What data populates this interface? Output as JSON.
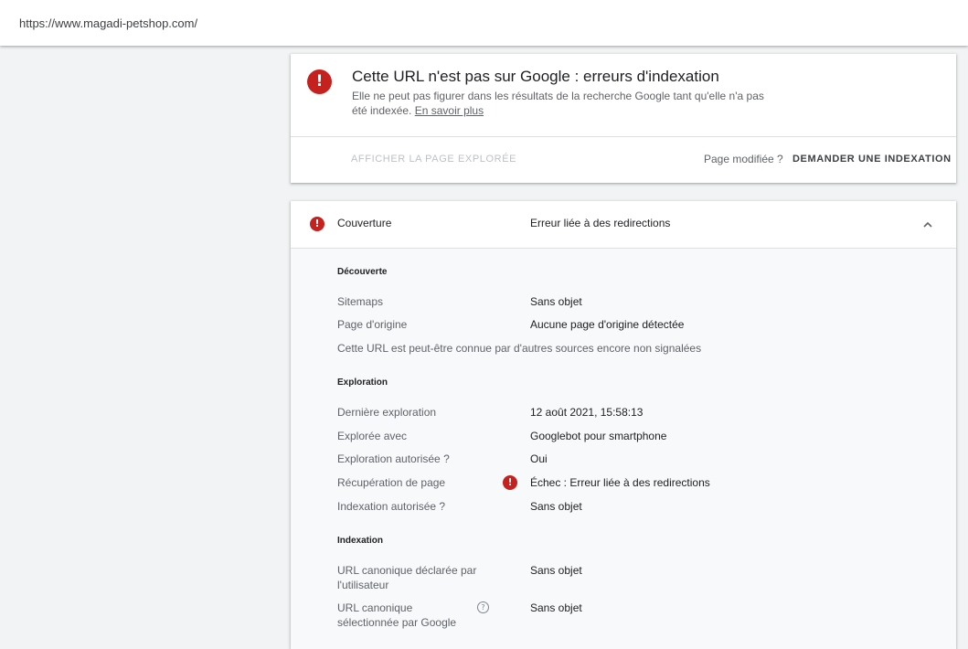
{
  "topbar": {
    "url": "https://www.magadi-petshop.com/"
  },
  "status": {
    "title": "Cette URL n'est pas sur Google : erreurs d'indexation",
    "description": "Elle ne peut pas figurer dans les résultats de la recherche Google tant qu'elle n'a pas été indexée.",
    "learn_more": "En savoir plus",
    "error_icon": "error-icon",
    "btn_view_crawled": "AFFICHER LA PAGE EXPLORÉE",
    "page_modified": "Page modifiée ?",
    "btn_request_index": "DEMANDER UNE INDEXATION"
  },
  "coverage": {
    "label": "Couverture",
    "value": "Erreur liée à des redirections",
    "discovery": {
      "title": "Découverte",
      "sitemaps_label": "Sitemaps",
      "sitemaps_value": "Sans objet",
      "referring_label": "Page d'origine",
      "referring_value": "Aucune page d'origine détectée",
      "note": "Cette URL est peut-être connue par d'autres sources encore non signalées"
    },
    "crawl": {
      "title": "Exploration",
      "last_crawl_label": "Dernière exploration",
      "last_crawl_value": "12 août 2021, 15:58:13",
      "crawled_as_label": "Explorée avec",
      "crawled_as_value": "Googlebot pour smartphone",
      "crawl_allowed_label": "Exploration autorisée ?",
      "crawl_allowed_value": "Oui",
      "page_fetch_label": "Récupération de page",
      "page_fetch_value": "Échec : Erreur liée à des redirections",
      "indexing_allowed_label": "Indexation autorisée ?",
      "indexing_allowed_value": "Sans objet"
    },
    "indexing": {
      "title": "Indexation",
      "user_canonical_label": "URL canonique déclarée par l'utilisateur",
      "user_canonical_value": "Sans objet",
      "google_canonical_label": "URL canonique sélectionnée par Google",
      "google_canonical_value": "Sans objet"
    }
  },
  "colors": {
    "error": "#c5221f",
    "background": "#f1f3f4"
  }
}
